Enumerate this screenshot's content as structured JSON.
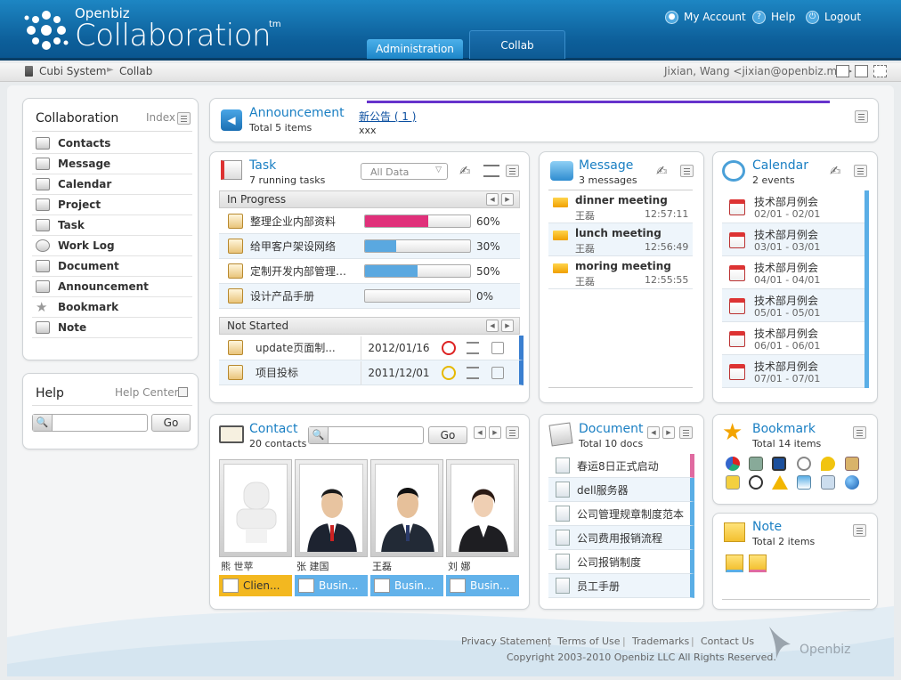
{
  "app": {
    "brand_small": "Openbiz",
    "brand_big": "Collaboration",
    "tm": "tm"
  },
  "header": {
    "my_account": "My Account",
    "help": "Help",
    "logout": "Logout",
    "tabs": [
      {
        "label": "Administration"
      },
      {
        "label": "Collab"
      }
    ]
  },
  "breadcrumb": {
    "root": "Cubi System",
    "current": "Collab",
    "user": "Jixian, Wang <jixian@openbiz.me>"
  },
  "sidebar": {
    "title": "Collaboration",
    "index_label": "Index",
    "items": [
      {
        "label": "Contacts",
        "icon": "contacts-icon"
      },
      {
        "label": "Message",
        "icon": "inbox-icon"
      },
      {
        "label": "Calendar",
        "icon": "calendar-icon"
      },
      {
        "label": "Project",
        "icon": "project-icon"
      },
      {
        "label": "Task",
        "icon": "task-icon"
      },
      {
        "label": "Work Log",
        "icon": "clock-icon"
      },
      {
        "label": "Document",
        "icon": "document-icon"
      },
      {
        "label": "Announcement",
        "icon": "speaker-icon"
      },
      {
        "label": "Bookmark",
        "icon": "star-icon"
      },
      {
        "label": "Note",
        "icon": "note-icon"
      }
    ]
  },
  "help": {
    "title": "Help",
    "center_label": "Help Center",
    "go": "Go"
  },
  "announcement": {
    "title": "Announcement",
    "subtitle": "Total 5 items",
    "headline": "新公告 ( 1 )",
    "text": "xxx"
  },
  "task": {
    "title": "Task",
    "subtitle": "7 running tasks",
    "filter": "All Data",
    "in_progress_label": "In Progress",
    "not_started_label": "Not Started",
    "in_progress": [
      {
        "name": "整理企业内部资料",
        "progress": 0.6,
        "pct": "60%",
        "color": "#e0307a"
      },
      {
        "name": "给甲客户架设网络",
        "progress": 0.3,
        "pct": "30%",
        "color": "#5aa8e0"
      },
      {
        "name": "定制开发内部管理系...",
        "progress": 0.5,
        "pct": "50%",
        "color": "#5aa8e0"
      },
      {
        "name": "设计产品手册",
        "progress": 0,
        "pct": "0%",
        "color": "#5aa8e0"
      }
    ],
    "not_started": [
      {
        "name": "update页面制...",
        "date": "2012/01/16",
        "priority": "high"
      },
      {
        "name": "项目投标",
        "date": "2011/12/01",
        "priority": "medium"
      }
    ]
  },
  "message": {
    "title": "Message",
    "subtitle": "3 messages",
    "items": [
      {
        "subject": "dinner meeting",
        "from": "王磊",
        "time": "12:57:11"
      },
      {
        "subject": "lunch meeting",
        "from": "王磊",
        "time": "12:56:49"
      },
      {
        "subject": "moring meeting",
        "from": "王磊",
        "time": "12:55:55"
      }
    ]
  },
  "calendar": {
    "title": "Calendar",
    "subtitle": "2 events",
    "items": [
      {
        "title": "技术部月例会",
        "range": "02/01 - 02/01"
      },
      {
        "title": "技术部月例会",
        "range": "03/01 - 03/01"
      },
      {
        "title": "技术部月例会",
        "range": "04/01 - 04/01"
      },
      {
        "title": "技术部月例会",
        "range": "05/01 - 05/01"
      },
      {
        "title": "技术部月例会",
        "range": "06/01 - 06/01"
      },
      {
        "title": "技术部月例会",
        "range": "07/01 - 07/01"
      }
    ]
  },
  "contact": {
    "title": "Contact",
    "subtitle": "20 contacts",
    "go": "Go",
    "people": [
      {
        "name": "熊 世苹",
        "tag": "Clien...",
        "tag_color": "#f3b820"
      },
      {
        "name": "张 建国",
        "tag": "Busin...",
        "tag_color": "#62b2ea"
      },
      {
        "name": "王磊",
        "tag": "Busin...",
        "tag_color": "#62b2ea"
      },
      {
        "name": "刘 娜",
        "tag": "Busin...",
        "tag_color": "#62b2ea"
      }
    ]
  },
  "document": {
    "title": "Document",
    "subtitle": "Total 10 docs",
    "items": [
      {
        "name": "春运8日正式启动"
      },
      {
        "name": "dell服务器"
      },
      {
        "name": "公司管理规章制度范本"
      },
      {
        "name": "公司费用报销流程"
      },
      {
        "name": "公司报销制度"
      },
      {
        "name": "员工手册"
      }
    ]
  },
  "bookmark": {
    "title": "Bookmark",
    "subtitle": "Total 14 items",
    "icons": [
      "pie-chart-icon",
      "spreadsheet-icon",
      "monitor-icon",
      "gauge-icon",
      "chat-bubble-icon",
      "certificate-icon",
      "pencil-icon",
      "play-icon",
      "warning-icon",
      "network-icon",
      "book-icon",
      "globe-icon"
    ]
  },
  "note": {
    "title": "Note",
    "subtitle": "Total 2 items"
  },
  "footer": {
    "privacy": "Privacy Statement",
    "terms": "Terms of Use",
    "trademarks": "Trademarks",
    "contact": "Contact Us",
    "copyright": "Copyright 2003-2010 Openbiz LLC All Rights Reserved.",
    "brand": "Openbiz"
  }
}
